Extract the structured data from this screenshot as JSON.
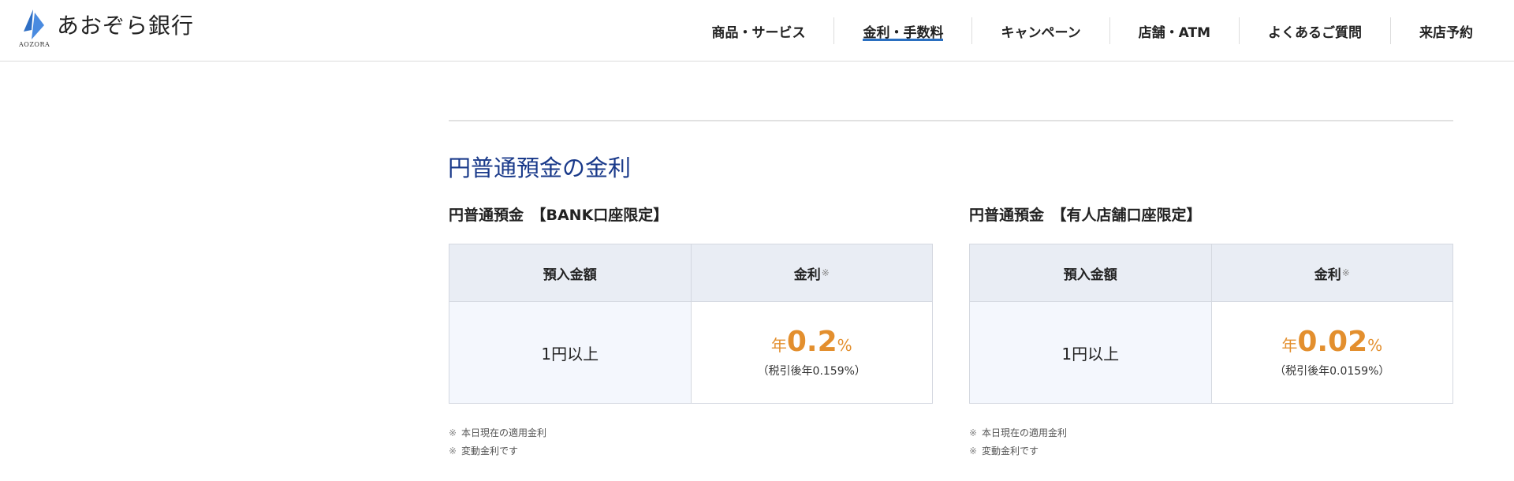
{
  "header": {
    "logo_text": "あおぞら銀行",
    "logo_sub": "AOZORA",
    "nav": [
      {
        "label": "商品・サービス",
        "active": false
      },
      {
        "label": "金利・手数料",
        "active": true
      },
      {
        "label": "キャンペーン",
        "active": false
      },
      {
        "label": "店舗・ATM",
        "active": false
      },
      {
        "label": "よくあるご質問",
        "active": false
      },
      {
        "label": "来店予約",
        "active": false
      }
    ]
  },
  "section": {
    "title": "円普通預金の金利"
  },
  "blocks": [
    {
      "title": "円普通預金　【BANK口座限定】",
      "col_amount": "預入金額",
      "col_rate": "金利",
      "col_rate_mark": "※",
      "amount": "1円以上",
      "rate_prefix": "年",
      "rate_value": "0.2",
      "rate_suffix": "%",
      "rate_after_tax": "（税引後年0.159%）",
      "notes": [
        {
          "mark": "※",
          "text": "本日現在の適用金利"
        },
        {
          "mark": "※",
          "text": "変動金利です"
        }
      ]
    },
    {
      "title": "円普通預金　【有人店舗口座限定】",
      "col_amount": "預入金額",
      "col_rate": "金利",
      "col_rate_mark": "※",
      "amount": "1円以上",
      "rate_prefix": "年",
      "rate_value": "0.02",
      "rate_suffix": "%",
      "rate_after_tax": "（税引後年0.0159%）",
      "notes": [
        {
          "mark": "※",
          "text": "本日現在の適用金利"
        },
        {
          "mark": "※",
          "text": "変動金利です"
        }
      ]
    }
  ],
  "colors": {
    "brand_blue": "#2a6fc0",
    "title_navy": "#1a3a8a",
    "rate_orange": "#e38f2e",
    "header_cell": "#e9edf4",
    "amount_cell": "#f4f7fd"
  },
  "icons": {
    "logo": "aozora-logo-icon"
  }
}
